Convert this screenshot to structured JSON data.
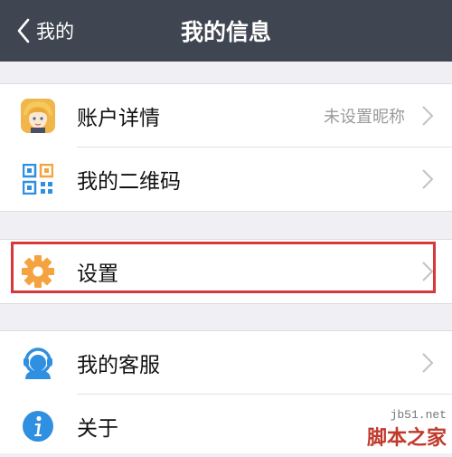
{
  "navbar": {
    "back_label": "我的",
    "title": "我的信息"
  },
  "groups": {
    "account": {
      "items": [
        {
          "label": "账户详情",
          "value": "未设置昵称",
          "icon": "avatar-icon"
        },
        {
          "label": "我的二维码",
          "icon": "qr-code-icon"
        }
      ]
    },
    "settings": {
      "items": [
        {
          "label": "设置",
          "icon": "gear-icon"
        }
      ]
    },
    "support": {
      "items": [
        {
          "label": "我的客服",
          "icon": "customer-service-icon"
        },
        {
          "label": "关于",
          "icon": "info-icon"
        }
      ]
    }
  },
  "watermark": {
    "url": "jb51.net",
    "name": "脚本之家"
  },
  "colors": {
    "navbar": "#3f4651",
    "background": "#efeff4",
    "gear": "#f4a340",
    "blue": "#2f8fe0",
    "highlight": "#d8383a"
  }
}
